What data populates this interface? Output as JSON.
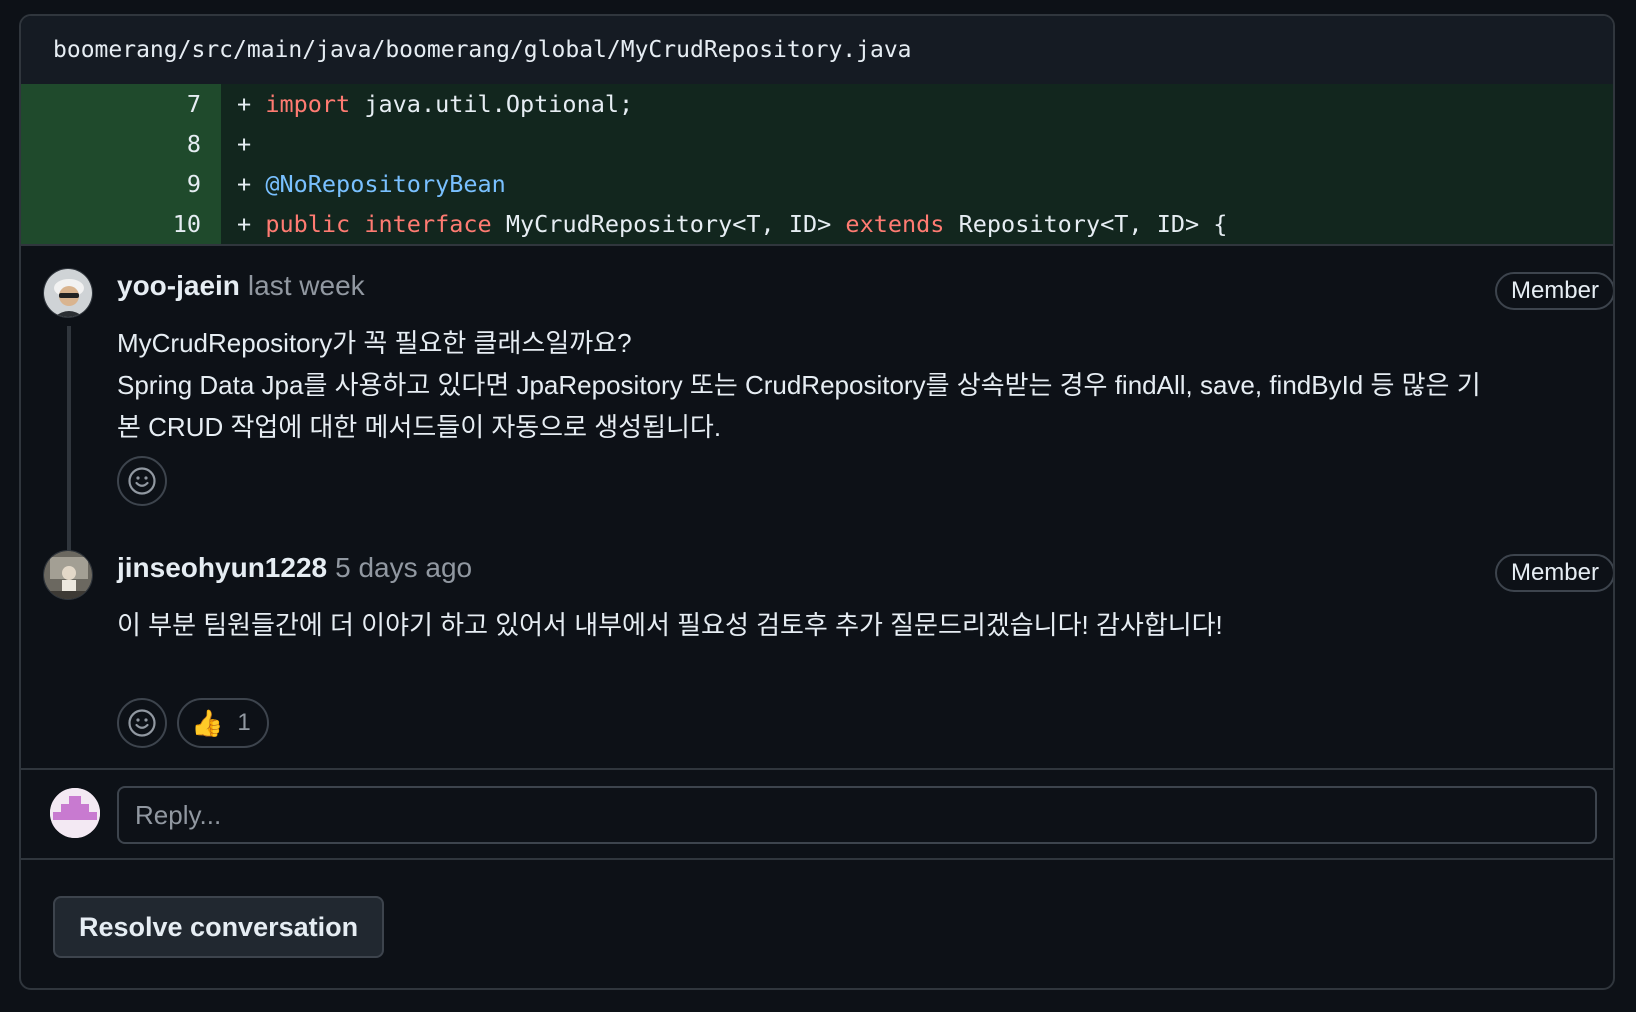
{
  "file": {
    "path": "boomerang/src/main/java/boomerang/global/MyCrudRepository.java"
  },
  "diff": {
    "lines": [
      {
        "num": "7",
        "marker": "+",
        "kw1": "import",
        "rest": " java.util.Optional;"
      },
      {
        "num": "8",
        "marker": "+"
      },
      {
        "num": "9",
        "marker": "+",
        "annotation": "@NoRepositoryBean"
      },
      {
        "num": "10",
        "marker": "+",
        "kw1": "public",
        "kw2": "interface",
        "mid": " MyCrudRepository<T, ID> ",
        "kw3": "extends",
        "rest": " Repository<T, ID> {"
      }
    ]
  },
  "comments": [
    {
      "author": "yoo-jaein",
      "time": "last week",
      "badge": "Member",
      "body_line1": "MyCrudRepository가 꼭 필요한 클래스일까요?",
      "body_line2": "Spring Data Jpa를 사용하고 있다면 JpaRepository 또는 CrudRepository를 상속받는 경우 findAll, save, findById 등 많은 기",
      "body_line3": "본 CRUD 작업에 대한 메서드들이 자동으로 생성됩니다."
    },
    {
      "author": "jinseohyun1228",
      "time": "5 days ago",
      "badge": "Member",
      "body_line1": "이 부분 팀원들간에 더 이야기 하고 있어서 내부에서 필요성 검토후 추가 질문드리겠습니다! 감사합니다!",
      "reaction": {
        "emoji": "👍",
        "count": "1"
      }
    }
  ],
  "reply": {
    "placeholder": "Reply..."
  },
  "actions": {
    "resolve_label": "Resolve conversation"
  },
  "icons": {
    "kebab": "kebab-horizontal-icon",
    "emoji": "smiley-icon"
  },
  "colors": {
    "background": "#0d1117",
    "addition_bg": "#12261e",
    "addition_num_bg": "#1f4a2c",
    "keyword": "#ff7b72",
    "annotation": "#79c0ff",
    "muted": "#9198a1"
  }
}
